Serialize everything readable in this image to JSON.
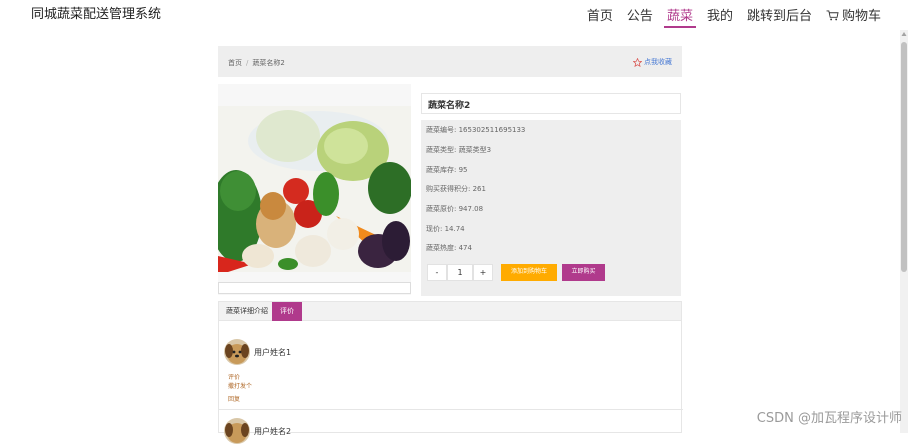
{
  "header": {
    "brand": "同城蔬菜配送管理系统",
    "nav": [
      {
        "label": "首页",
        "active": false
      },
      {
        "label": "公告",
        "active": false
      },
      {
        "label": "蔬菜",
        "active": true
      },
      {
        "label": "我的",
        "active": false
      },
      {
        "label": "跳转到后台",
        "active": false
      },
      {
        "label": "购物车",
        "active": false,
        "icon": "cart-icon"
      }
    ]
  },
  "breadcrumb": {
    "home": "首页",
    "separator": "/",
    "current": "蔬菜名称2",
    "favorite_label": "点我收藏",
    "favorite_icon": "star-outline-icon"
  },
  "product": {
    "name": "蔬菜名称2",
    "fields": [
      "蔬菜编号: 165302511695133",
      "蔬菜类型: 蔬菜类型3",
      "蔬菜库存: 95",
      "购买获得积分: 261",
      "蔬菜原价: 947.08",
      "现价: 14.74",
      "蔬菜热度: 474"
    ],
    "quantity": {
      "minus": "-",
      "value": "1",
      "plus": "+"
    },
    "add_to_cart_label": "添加到购物车",
    "buy_now_label": "立即购买"
  },
  "tabs": [
    {
      "label": "蔬菜详细介绍",
      "active": false
    },
    {
      "label": "评价",
      "active": true
    }
  ],
  "reviews": [
    {
      "username": "用户姓名1",
      "comment_label": "评价",
      "comment": "撒打发个",
      "reply_label": "回复"
    },
    {
      "username": "用户姓名2"
    }
  ],
  "watermark": "CSDN @加瓦程序设计师",
  "colors": {
    "accent": "#b03a8c",
    "cart_button": "#ffab00",
    "favorite": "#4a7bd4",
    "panel_bg": "#eeeeee"
  }
}
